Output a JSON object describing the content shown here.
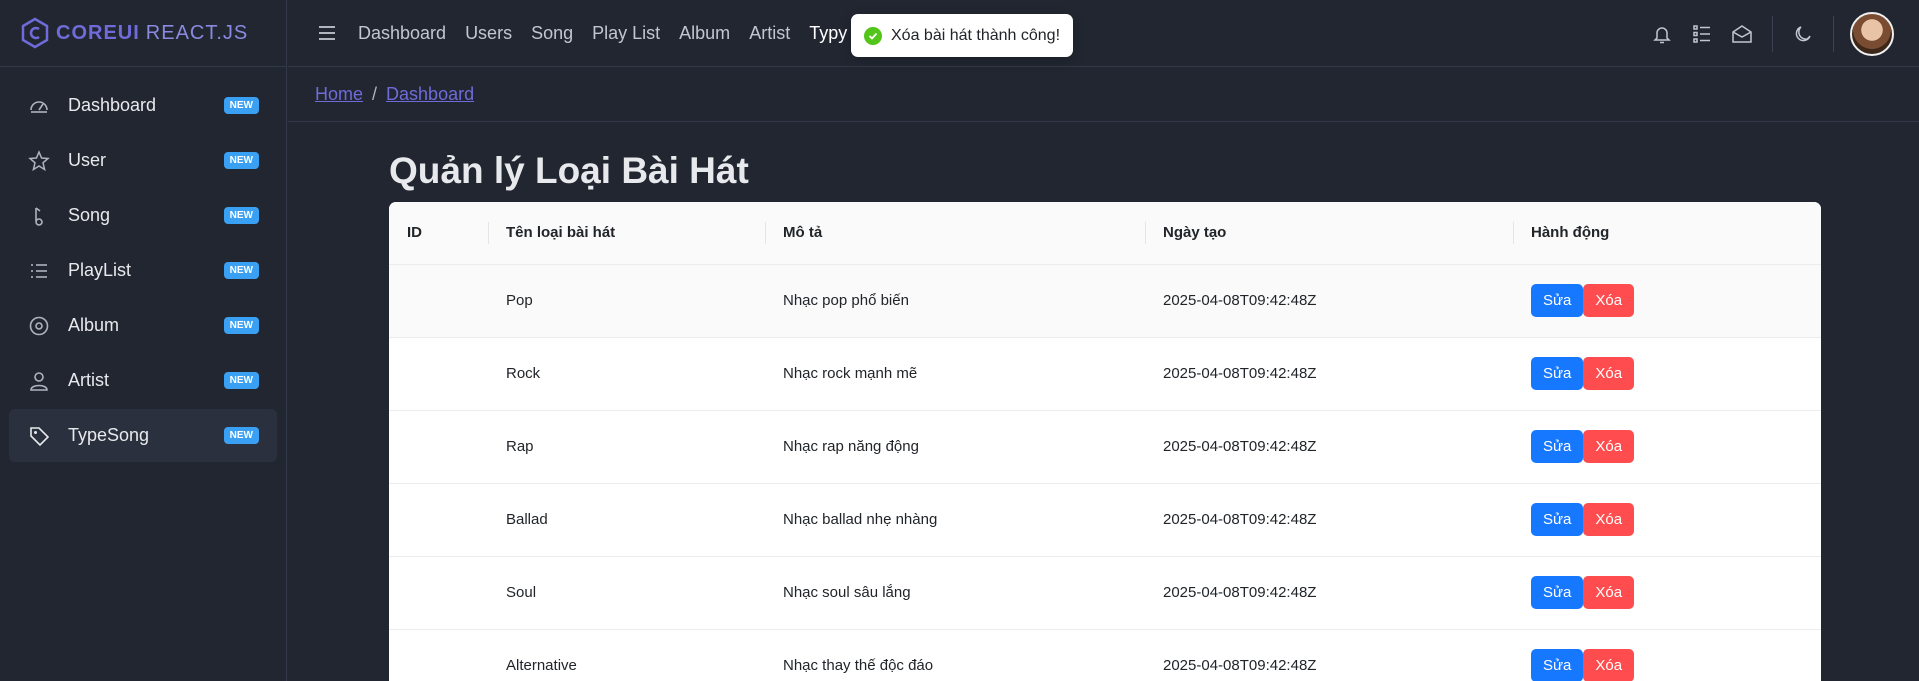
{
  "brand": {
    "name_bold": "COREUI",
    "name_light": "REACT.JS"
  },
  "sidebar": {
    "items": [
      {
        "label": "Dashboard",
        "badge": "NEW",
        "icon": "speedometer-icon"
      },
      {
        "label": "User",
        "badge": "NEW",
        "icon": "star-icon"
      },
      {
        "label": "Song",
        "badge": "NEW",
        "icon": "music-note-icon"
      },
      {
        "label": "PlayList",
        "badge": "NEW",
        "icon": "list-icon"
      },
      {
        "label": "Album",
        "badge": "NEW",
        "icon": "disc-icon"
      },
      {
        "label": "Artist",
        "badge": "NEW",
        "icon": "user-icon"
      },
      {
        "label": "TypeSong",
        "badge": "NEW",
        "icon": "tag-icon"
      }
    ]
  },
  "header": {
    "links": [
      "Dashboard",
      "Users",
      "Song",
      "Play List",
      "Album",
      "Artist",
      "Typy Song"
    ]
  },
  "breadcrumb": {
    "home": "Home",
    "current": "Dashboard"
  },
  "toast": {
    "message": "Xóa bài hát thành công!"
  },
  "main": {
    "title": "Quản lý Loại Bài Hát",
    "columns": [
      "ID",
      "Tên loại bài hát",
      "Mô tả",
      "Ngày tạo",
      "Hành động"
    ],
    "edit_label": "Sửa",
    "delete_label": "Xóa",
    "rows": [
      {
        "id": "",
        "name": "Pop",
        "desc": "Nhạc pop phổ biến",
        "created": "2025-04-08T09:42:48Z"
      },
      {
        "id": "",
        "name": "Rock",
        "desc": "Nhạc rock mạnh mẽ",
        "created": "2025-04-08T09:42:48Z"
      },
      {
        "id": "",
        "name": "Rap",
        "desc": "Nhạc rap năng động",
        "created": "2025-04-08T09:42:48Z"
      },
      {
        "id": "",
        "name": "Ballad",
        "desc": "Nhạc ballad nhẹ nhàng",
        "created": "2025-04-08T09:42:48Z"
      },
      {
        "id": "",
        "name": "Soul",
        "desc": "Nhạc soul sâu lắng",
        "created": "2025-04-08T09:42:48Z"
      },
      {
        "id": "",
        "name": "Alternative",
        "desc": "Nhạc thay thế độc đáo",
        "created": "2025-04-08T09:42:48Z"
      }
    ]
  },
  "colors": {
    "accent": "#6f6bd9",
    "edit": "#1677ff",
    "delete": "#ff4d4f",
    "badge": "#3aa0f3"
  }
}
